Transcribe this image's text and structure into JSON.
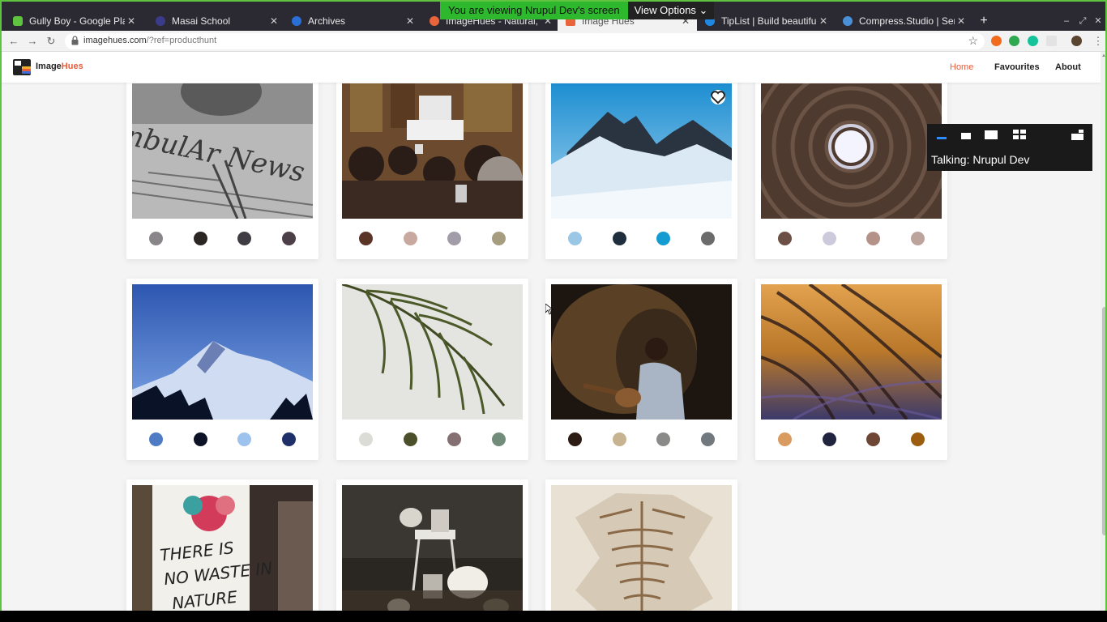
{
  "zoom": {
    "banner_text": "You are viewing Nrupul Dev's screen",
    "view_options": "View Options",
    "talking": "Talking: Nrupul Dev"
  },
  "browser": {
    "tabs": [
      {
        "title": "Gully Boy - Google Play M",
        "favicon_color": "#5ec43f"
      },
      {
        "title": "Masai School",
        "favicon_color": "#3b3b8c"
      },
      {
        "title": "Archives",
        "favicon_color": "#2a6fd6"
      },
      {
        "title": "ImageHues - Natural, fre",
        "favicon_color": "#e9643a"
      },
      {
        "title": "Image Hues",
        "favicon_color": "#e9643a",
        "active": true
      },
      {
        "title": "TipList | Build beautiful t",
        "favicon_color": "#1e88e5"
      },
      {
        "title": "Compress.Studio | Serve",
        "favicon_color": "#4a90d9"
      }
    ],
    "new_tab": "+",
    "url_host": "imagehues.com",
    "url_rest": "/?ref=producthunt"
  },
  "site": {
    "logo_main": "Image",
    "logo_accent": "Hues",
    "nav": {
      "home": "Home",
      "favourites": "Favourites",
      "about": "About"
    }
  },
  "gallery": [
    {
      "name": "newspaper",
      "colors": [
        "#89868a",
        "#2b2624",
        "#3f3c43",
        "#4c3f48"
      ]
    },
    {
      "name": "museum-crowd",
      "colors": [
        "#5a3527",
        "#c9a8a0",
        "#a29ca8",
        "#a69d80"
      ]
    },
    {
      "name": "snowy-mountain",
      "colors": [
        "#9ac7e6",
        "#1f2e3d",
        "#139bd2",
        "#6b6b6b"
      ],
      "favourite_button": true
    },
    {
      "name": "dome-oculus",
      "colors": [
        "#6c5045",
        "#cdcadb",
        "#b59288",
        "#bca49c"
      ]
    },
    {
      "name": "blue-mountain",
      "colors": [
        "#4e7bc4",
        "#0d1326",
        "#9dc2ee",
        "#1e2f69"
      ]
    },
    {
      "name": "palm-leaf",
      "colors": [
        "#dcdcd7",
        "#4b502a",
        "#846f72",
        "#718c7a"
      ]
    },
    {
      "name": "guitar-singer",
      "colors": [
        "#2c1c14",
        "#c8b391",
        "#8a8a88",
        "#71787e"
      ]
    },
    {
      "name": "golden-grass",
      "colors": [
        "#d99b60",
        "#21243e",
        "#6d4635",
        "#9c5d10"
      ]
    },
    {
      "name": "no-waste-sign",
      "colors": []
    },
    {
      "name": "pumpkins-stool",
      "colors": []
    },
    {
      "name": "fossil",
      "colors": []
    }
  ]
}
